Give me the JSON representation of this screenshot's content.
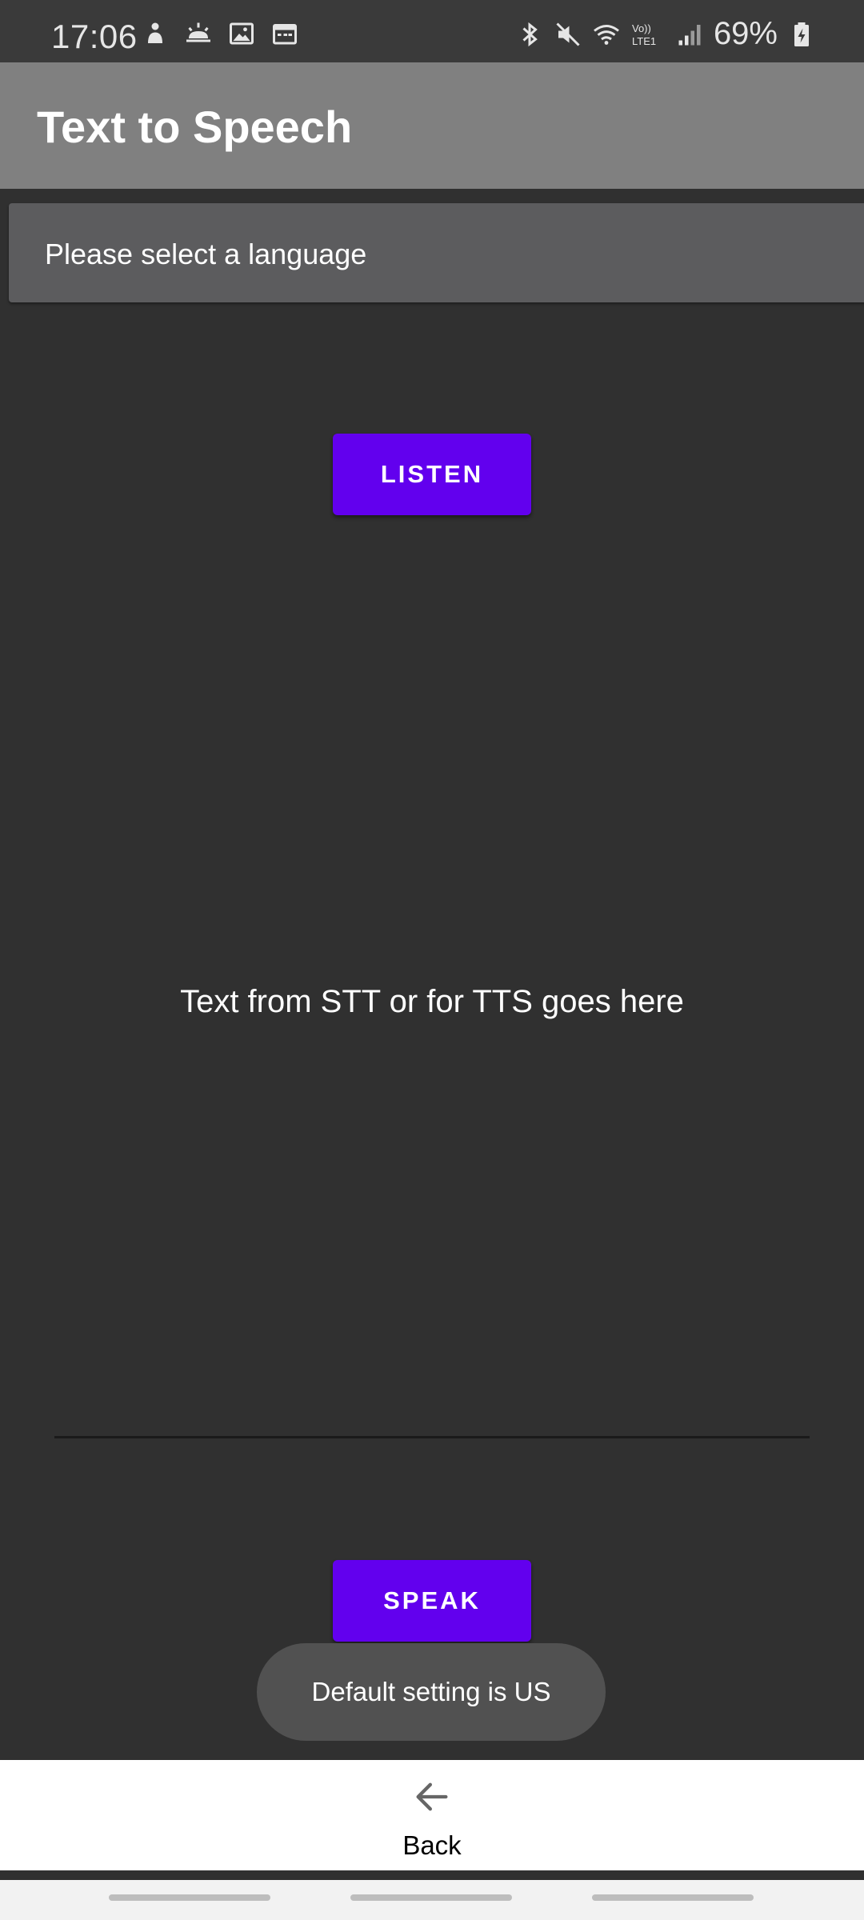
{
  "status_bar": {
    "time": "17:06",
    "battery": "69%",
    "network": "Vo)) LTE1",
    "left_icons": [
      "notification-app-icon",
      "weather-icon",
      "gallery-icon",
      "calendar-icon"
    ],
    "right_icons": [
      "bluetooth-icon",
      "mute-icon",
      "wifi-icon",
      "lte-icon",
      "signal-icon",
      "battery-charging-icon"
    ]
  },
  "app_bar": {
    "title": "Text to Speech"
  },
  "language_spinner": {
    "label": "Please select a language"
  },
  "main": {
    "listen_label": "LISTEN",
    "text_display": "Text from STT or for TTS goes here",
    "speak_label": "SPEAK"
  },
  "toast": {
    "message": "Default setting is US"
  },
  "bottom_panel": {
    "back_label": "Back",
    "back_icon": "arrow-left-icon"
  },
  "colors": {
    "accent": "#6200ee",
    "background": "#303030",
    "app_bar": "#808080"
  }
}
